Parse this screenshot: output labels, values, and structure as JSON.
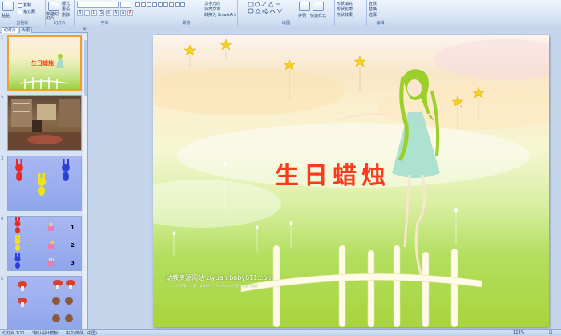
{
  "ribbon": {
    "clipboard": {
      "paste": "粘贴",
      "copy": "复制",
      "format_painter": "格式刷",
      "label": "剪贴板"
    },
    "slides": {
      "new_slide": "新建幻灯片",
      "layout": "版式",
      "reset": "重设",
      "delete": "删除",
      "label": "幻灯片"
    },
    "font": {
      "label": "字体"
    },
    "paragraph": {
      "text_direction": "文字方向",
      "align_text": "对齐文本",
      "smartart": "转换为 SmartArt",
      "label": "段落"
    },
    "drawing": {
      "arrange": "排列",
      "quick_styles": "快速样式",
      "shape_fill": "形状填充",
      "shape_outline": "形状轮廓",
      "shape_effects": "形状效果",
      "label": "绘图"
    },
    "editing": {
      "find": "查找",
      "replace": "替换",
      "select": "选择",
      "label": "编辑"
    }
  },
  "panel": {
    "tabs": {
      "slides": "幻灯片",
      "outline": "大纲"
    },
    "slide_numbers": [
      "1",
      "2",
      "3",
      "4",
      "5"
    ],
    "thumb1_title": "生日蜡烛",
    "thumb4_numbers": [
      "1",
      "2",
      "3"
    ]
  },
  "slide": {
    "title": "生日蜡烛",
    "brand": "幼教资源网站 ziyuan.baby611.com",
    "brand_sub": "课件下载 · 儿歌 · 故事MP3 · FLASH课件下载 · 试卷下载库"
  },
  "status": {
    "slide_info": "幻灯片 1/11",
    "theme": "\"默认设计模板\"",
    "language": "中文(简体，中国)",
    "zoom": "123%"
  },
  "colors": {
    "title": "#ff3a1a",
    "accent": "#f0a030",
    "ribbon_border": "#8ea9d2"
  }
}
